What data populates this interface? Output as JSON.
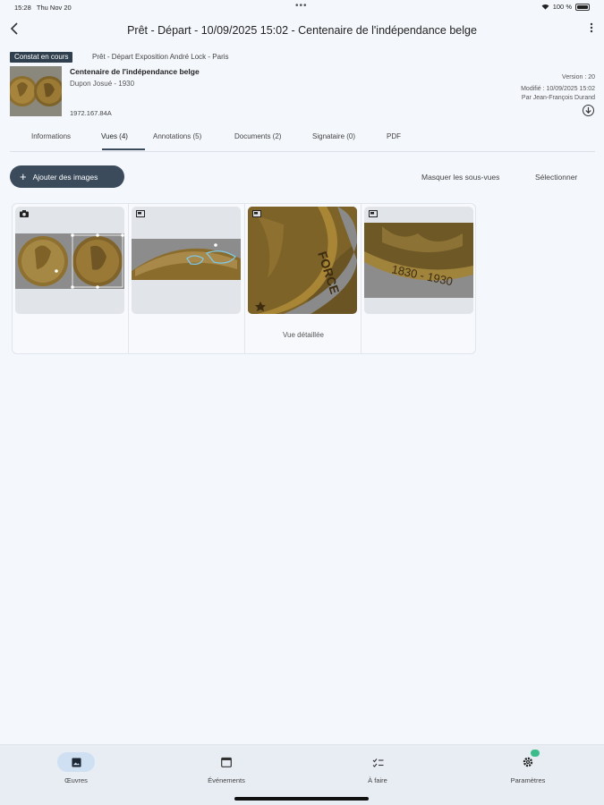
{
  "status_bar": {
    "time": "15:28",
    "date": "Thu Nov 20",
    "battery": "100 %"
  },
  "header": {
    "title": "Prêt - Départ - 10/09/2025 15:02 - Centenaire de l'indépendance belge"
  },
  "record": {
    "status_chip": "Constat en cours",
    "context": "Prêt - Départ  Exposition André Lock - Paris",
    "title": "Centenaire de l'indépendance belge",
    "author": "Dupon Josué - 1930",
    "inventory": "1972.167.84A",
    "version": "Version : 20",
    "modified": "Modifié : 10/09/2025 15:02",
    "modified_by": "Par Jean-François Durand"
  },
  "tabs": [
    {
      "label": "Informations"
    },
    {
      "label": "Vues (4)"
    },
    {
      "label": "Annotations (5)"
    },
    {
      "label": "Documents (2)"
    },
    {
      "label": "Signataire (0)"
    },
    {
      "label": "PDF"
    }
  ],
  "actions": {
    "add_images": "Ajouter des images",
    "hide_subviews": "Masquer les sous-vues",
    "select": "Sélectionner"
  },
  "gallery": {
    "cards": [
      {
        "type": "camera-icon",
        "label": ""
      },
      {
        "type": "image-icon",
        "label": ""
      },
      {
        "type": "image-icon",
        "label": "Vue détaillée"
      },
      {
        "type": "image-icon",
        "label": ""
      }
    ]
  },
  "bottom_nav": [
    {
      "label": "Œuvres",
      "icon": "image-icon",
      "active": true
    },
    {
      "label": "Événements",
      "icon": "calendar-icon",
      "active": false
    },
    {
      "label": "À faire",
      "icon": "checklist-icon",
      "active": false
    },
    {
      "label": "Paramètres",
      "icon": "gear-icon",
      "active": false
    }
  ],
  "colors": {
    "accent": "#3b4b5b",
    "nav_active": "#cfe0f3",
    "badge": "#3dbb8a",
    "background": "#f4f7fc"
  }
}
